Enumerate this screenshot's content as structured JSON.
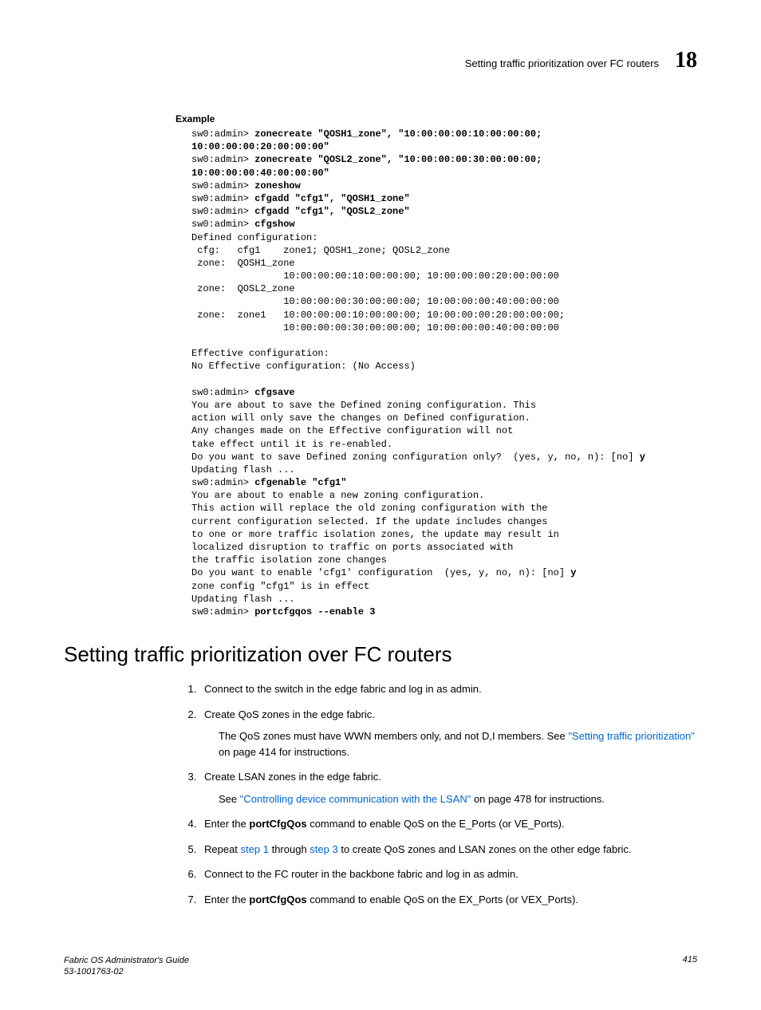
{
  "header": {
    "title": "Setting traffic prioritization over FC routers",
    "chapter": "18"
  },
  "example": {
    "label": "Example",
    "lines": [
      {
        "plain": "sw0:admin> ",
        "bold": "zonecreate \"QOSH1_zone\", \"10:00:00:00:10:00:00:00;"
      },
      {
        "bold": "10:00:00:00:20:00:00:00\""
      },
      {
        "plain": "sw0:admin> ",
        "bold": "zonecreate \"QOSL2_zone\", \"10:00:00:00:30:00:00:00;"
      },
      {
        "bold": "10:00:00:00:40:00:00:00\""
      },
      {
        "plain": "sw0:admin> ",
        "bold": "zoneshow"
      },
      {
        "plain": "sw0:admin> ",
        "bold": "cfgadd \"cfg1\", \"QOSH1_zone\""
      },
      {
        "plain": "sw0:admin> ",
        "bold": "cfgadd \"cfg1\", \"QOSL2_zone\""
      },
      {
        "plain": "sw0:admin> ",
        "bold": "cfgshow"
      },
      {
        "plain": "Defined configuration:"
      },
      {
        "plain": " cfg:   cfg1    zone1; QOSH1_zone; QOSL2_zone"
      },
      {
        "plain": " zone:  QOSH1_zone"
      },
      {
        "plain": "                10:00:00:00:10:00:00:00; 10:00:00:00:20:00:00:00"
      },
      {
        "plain": " zone:  QOSL2_zone"
      },
      {
        "plain": "                10:00:00:00:30:00:00:00; 10:00:00:00:40:00:00:00"
      },
      {
        "plain": " zone:  zone1   10:00:00:00:10:00:00:00; 10:00:00:00:20:00:00:00;"
      },
      {
        "plain": "                10:00:00:00:30:00:00:00; 10:00:00:00:40:00:00:00"
      },
      {
        "plain": ""
      },
      {
        "plain": "Effective configuration:"
      },
      {
        "plain": "No Effective configuration: (No Access)"
      },
      {
        "plain": ""
      },
      {
        "plain": "sw0:admin> ",
        "bold": "cfgsave"
      },
      {
        "plain": "You are about to save the Defined zoning configuration. This"
      },
      {
        "plain": "action will only save the changes on Defined configuration."
      },
      {
        "plain": "Any changes made on the Effective configuration will not"
      },
      {
        "plain": "take effect until it is re-enabled."
      },
      {
        "plain": "Do you want to save Defined zoning configuration only?  (yes, y, no, n): [no] ",
        "bold": "y"
      },
      {
        "plain": "Updating flash ..."
      },
      {
        "plain": "sw0:admin> ",
        "bold": "cfgenable \"cfg1\""
      },
      {
        "plain": "You are about to enable a new zoning configuration."
      },
      {
        "plain": "This action will replace the old zoning configuration with the"
      },
      {
        "plain": "current configuration selected. If the update includes changes"
      },
      {
        "plain": "to one or more traffic isolation zones, the update may result in"
      },
      {
        "plain": "localized disruption to traffic on ports associated with"
      },
      {
        "plain": "the traffic isolation zone changes"
      },
      {
        "plain": "Do you want to enable 'cfg1' configuration  (yes, y, no, n): [no] ",
        "bold": "y"
      },
      {
        "plain": "zone config \"cfg1\" is in effect"
      },
      {
        "plain": "Updating flash ..."
      },
      {
        "plain": "sw0:admin> ",
        "bold": "portcfgqos --enable 3"
      }
    ]
  },
  "section": {
    "title": "Setting traffic prioritization over FC routers"
  },
  "steps": {
    "s1": "Connect to the switch in the edge fabric and log in as admin.",
    "s2": "Create QoS zones in the edge fabric.",
    "s2_sub_pre": "The QoS zones must have WWN members only, and not D,I members. See ",
    "s2_link": "\"Setting traffic prioritization\"",
    "s2_sub_post": " on page 414 for instructions.",
    "s3": "Create LSAN zones in the edge fabric.",
    "s3_sub_pre": "See ",
    "s3_link": "\"Controlling device communication with the LSAN\"",
    "s3_sub_post": " on page 478 for instructions.",
    "s4_pre": "Enter the ",
    "s4_cmd": "portCfgQos",
    "s4_post": " command to enable QoS on the E_Ports (or VE_Ports).",
    "s5_pre": "Repeat ",
    "s5_link1": "step 1",
    "s5_mid": " through ",
    "s5_link2": "step 3",
    "s5_post": " to create QoS zones and LSAN zones on the other edge fabric.",
    "s6": "Connect to the FC router in the backbone fabric and log in as admin.",
    "s7_pre": "Enter the ",
    "s7_cmd": "portCfgQos",
    "s7_post": " command to enable QoS on the EX_Ports (or VEX_Ports)."
  },
  "footer": {
    "guide": "Fabric OS Administrator's Guide",
    "docnum": "53-1001763-02",
    "page": "415"
  }
}
